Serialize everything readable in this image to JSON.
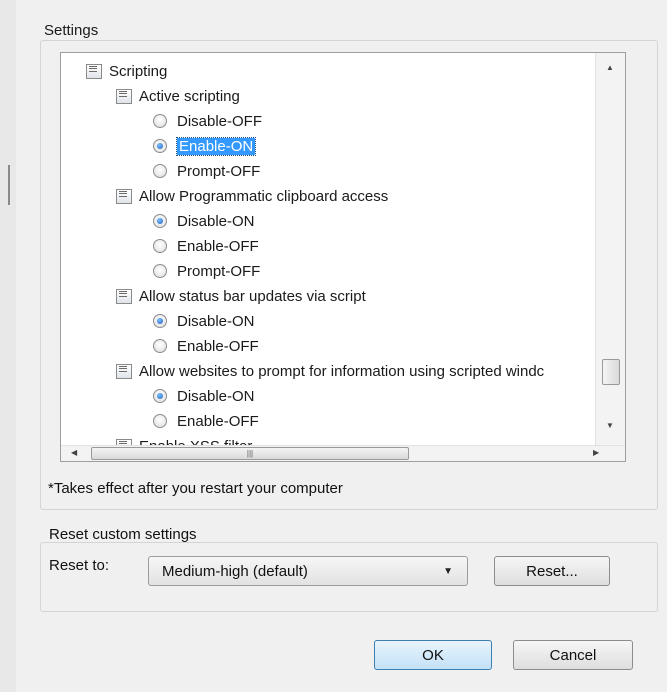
{
  "settings": {
    "title": "Settings",
    "tree": [
      {
        "type": "category",
        "label": "Scripting"
      },
      {
        "type": "setting",
        "label": "Active scripting"
      },
      {
        "type": "option",
        "label": "Disable-OFF",
        "checked": false
      },
      {
        "type": "option",
        "label": "Enable-ON",
        "checked": true,
        "selected": true
      },
      {
        "type": "option",
        "label": "Prompt-OFF",
        "checked": false
      },
      {
        "type": "setting",
        "label": "Allow Programmatic clipboard access"
      },
      {
        "type": "option",
        "label": "Disable-ON",
        "checked": true
      },
      {
        "type": "option",
        "label": "Enable-OFF",
        "checked": false
      },
      {
        "type": "option",
        "label": "Prompt-OFF",
        "checked": false
      },
      {
        "type": "setting",
        "label": "Allow status bar updates via script"
      },
      {
        "type": "option",
        "label": "Disable-ON",
        "checked": true
      },
      {
        "type": "option",
        "label": "Enable-OFF",
        "checked": false
      },
      {
        "type": "setting",
        "label": "Allow websites to prompt for information using scripted windc"
      },
      {
        "type": "option",
        "label": "Disable-ON",
        "checked": true
      },
      {
        "type": "option",
        "label": "Enable-OFF",
        "checked": false
      },
      {
        "type": "setting",
        "label": "Enable XSS filter"
      }
    ],
    "note": "*Takes effect after you restart your computer"
  },
  "reset": {
    "title": "Reset custom settings",
    "reset_to_label": "Reset to:",
    "selected_value": "Medium-high (default)",
    "reset_button": "Reset..."
  },
  "footer": {
    "ok": "OK",
    "cancel": "Cancel"
  }
}
